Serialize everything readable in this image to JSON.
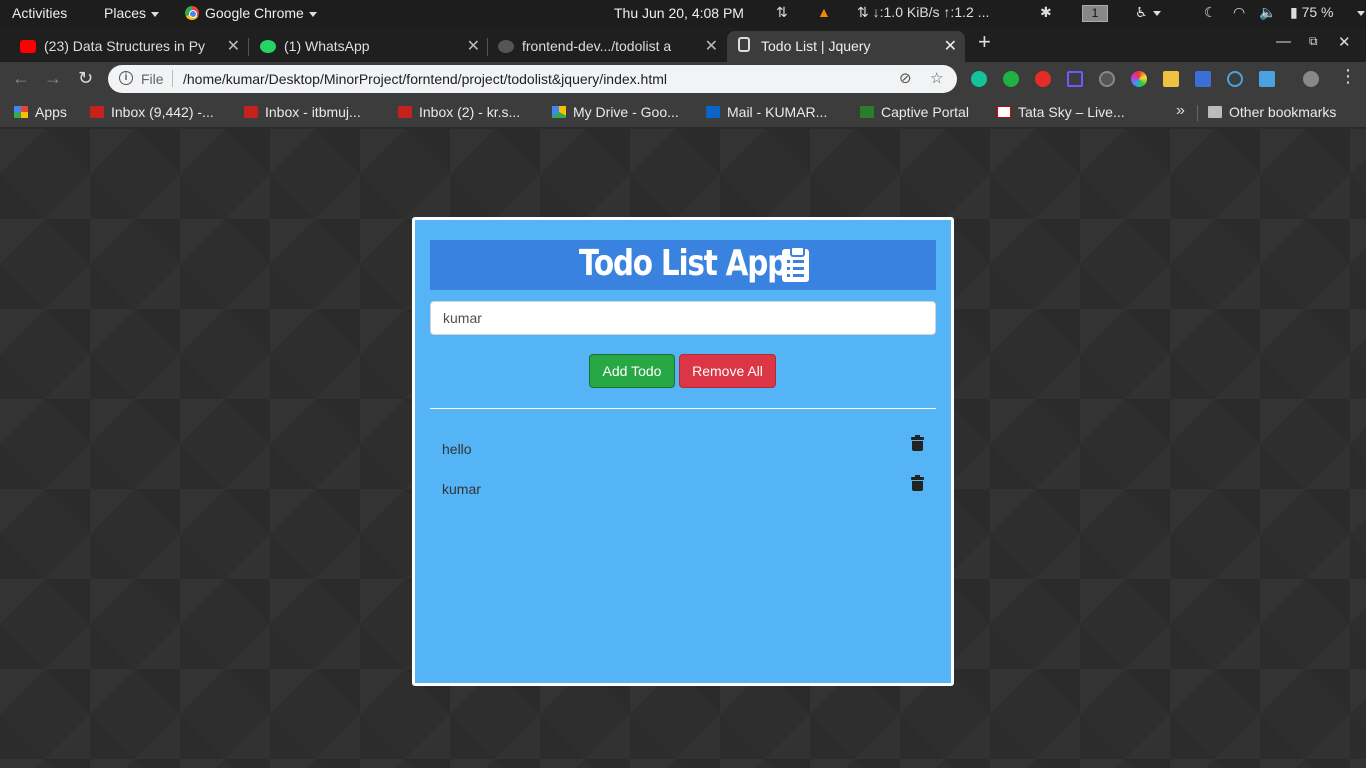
{
  "topbar": {
    "activities": "Activities",
    "places": "Places",
    "app": "Google Chrome",
    "clock": "Thu Jun 20,  4:08 PM",
    "net_speed": "↓:1.0 KiB/s ↑:1.2 ...",
    "workspace": "1",
    "battery": "75 %"
  },
  "tabs": [
    {
      "title": "(23) Data Structures in Py",
      "favicon": "youtube-icon",
      "color": "#ff0000"
    },
    {
      "title": "(1) WhatsApp",
      "favicon": "whatsapp-icon",
      "color": "#25d366"
    },
    {
      "title": "frontend-dev.../todolist a",
      "favicon": "github-icon",
      "color": "#555555"
    },
    {
      "title": "Todo List | Jquery",
      "favicon": "page-icon",
      "color": "#dddddd",
      "active": true
    }
  ],
  "omnibox": {
    "scheme": "File",
    "url": "/home/kumar/Desktop/MinorProject/forntend/project/todolist&jquery/index.html"
  },
  "bookmarks": [
    {
      "label": "Apps",
      "icon": "apps-grid-icon"
    },
    {
      "label": "Inbox (9,442) -...",
      "icon": "gmail-icon"
    },
    {
      "label": "Inbox - itbmuj...",
      "icon": "gmail-icon"
    },
    {
      "label": "Inbox (2) - kr.s...",
      "icon": "gmail-icon"
    },
    {
      "label": "My Drive - Goo...",
      "icon": "drive-icon"
    },
    {
      "label": "Mail - KUMAR...",
      "icon": "outlook-icon"
    },
    {
      "label": "Captive Portal",
      "icon": "portal-icon"
    },
    {
      "label": "Tata Sky – Live...",
      "icon": "tatasky-icon"
    }
  ],
  "other_bookmarks": "Other bookmarks",
  "app": {
    "title": "Todo List App",
    "input_value": "kumar",
    "add_label": "Add Todo",
    "remove_label": "Remove All",
    "todos": [
      "hello",
      "kumar"
    ],
    "colors": {
      "card": "#54b4f6",
      "header": "#3a82e0",
      "add": "#28a745",
      "remove": "#dc3545"
    }
  }
}
